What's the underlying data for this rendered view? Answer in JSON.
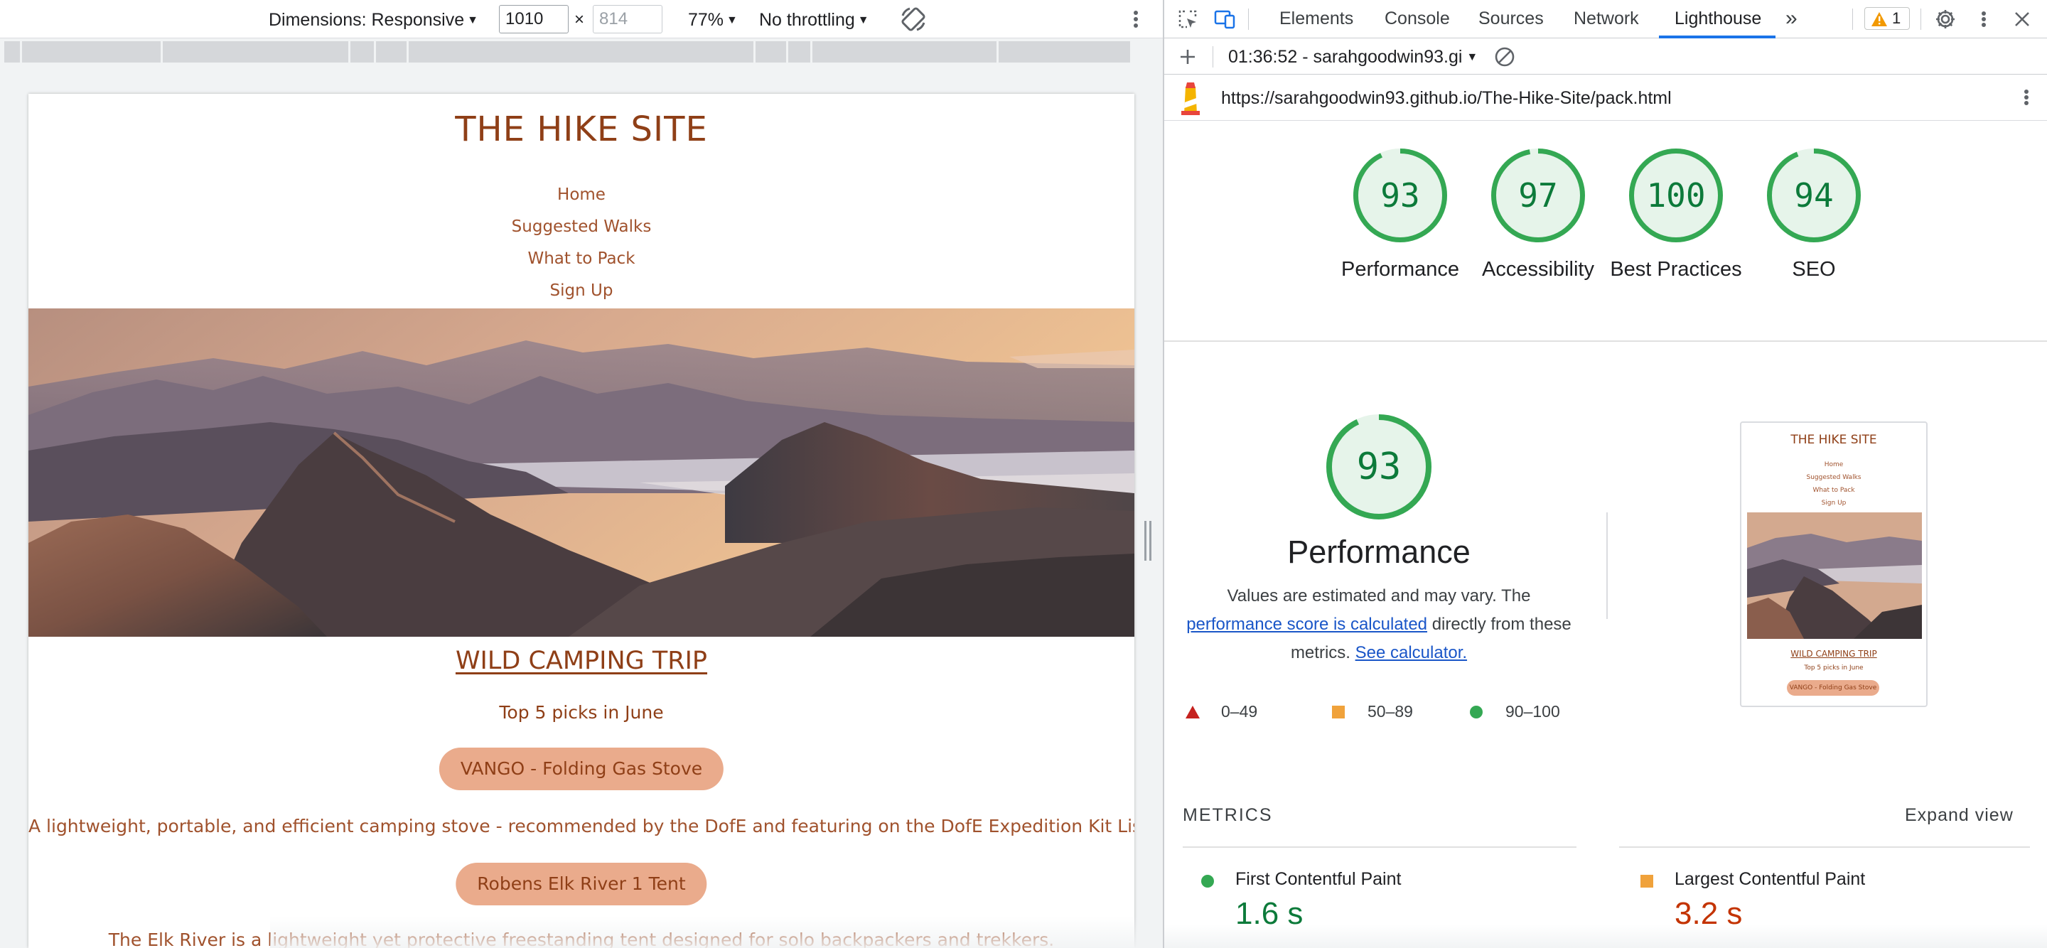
{
  "device_toolbar": {
    "dimensions_label": "Dimensions: Responsive",
    "width_value": "1010",
    "height_placeholder": "814",
    "times": "×",
    "zoom": "77%",
    "throttling": "No throttling",
    "rotate_icon": "rotate-icon",
    "more_icon": "more-vert-icon"
  },
  "site": {
    "title": "THE HIKE SITE",
    "nav": [
      "Home",
      "Suggested Walks",
      "What to Pack",
      "Sign Up"
    ],
    "hero_image": "mountain-sunset-hero-image",
    "heading": "WILD CAMPING TRIP",
    "subheading": "Top 5 picks in June",
    "items": [
      {
        "name": "VANGO - Folding Gas Stove",
        "description": "A lightweight, portable, and efficient camping stove - recommended by the DofE and featuring on the DofE Expedition Kit List."
      },
      {
        "name": "Robens Elk River 1 Tent",
        "description": "The Elk River is a lightweight yet protective freestanding tent designed for solo backpackers and trekkers."
      }
    ]
  },
  "devtools": {
    "tabs": [
      "Elements",
      "Console",
      "Sources",
      "Network",
      "Lighthouse"
    ],
    "active_tab": "Lighthouse",
    "more_tabs": "»",
    "issues_count": "1",
    "icons": {
      "inspect": "inspect-element-icon",
      "device": "device-toggle-icon",
      "settings": "gear-icon",
      "more": "more-vert-icon",
      "close": "close-icon",
      "warning": "warning-icon"
    },
    "lighthouse_toolbar": {
      "add_icon": "plus-icon",
      "report_label": "01:36:52 - sarahgoodwin93.gi",
      "clear_icon": "clear-icon"
    },
    "url": "https://sarahgoodwin93.github.io/The-Hike-Site/pack.html",
    "lighthouse_logo": "lighthouse-logo-icon",
    "scores": [
      {
        "label": "Performance",
        "value": 93
      },
      {
        "label": "Accessibility",
        "value": 97
      },
      {
        "label": "Best Practices",
        "value": 100
      },
      {
        "label": "SEO",
        "value": 94
      }
    ],
    "performance": {
      "score": 93,
      "title": "Performance",
      "desc_prefix": "Values are estimated and may vary. The",
      "desc_link": "performance score is calculated",
      "desc_middle": "directly from these metrics.",
      "calc_link": "See calculator."
    },
    "legend": [
      {
        "range": "0–49",
        "color": "#c5221f",
        "shape": "triangle"
      },
      {
        "range": "50–89",
        "color": "#f0a23b",
        "shape": "square"
      },
      {
        "range": "90–100",
        "color": "#34a853",
        "shape": "circle"
      }
    ],
    "thumbnail": {
      "title": "THE HIKE SITE",
      "nav": [
        "Home",
        "Suggested Walks",
        "What to Pack",
        "Sign Up"
      ],
      "heading": "WILD CAMPING TRIP",
      "subheading": "Top 5 picks in June",
      "pill": "VANGO - Folding Gas Stove"
    },
    "metrics": {
      "title": "METRICS",
      "expand": "Expand view",
      "items": [
        {
          "label": "First Contentful Paint",
          "value": "1.6 s",
          "status": "pass",
          "color": "#0c7a3a"
        },
        {
          "label": "Largest Contentful Paint",
          "value": "3.2 s",
          "status": "average",
          "color": "#c33300"
        }
      ]
    },
    "colors": {
      "pass": "#0c7a3a",
      "ring": "#34a853",
      "ring_bg": "#e6f4ea",
      "accent": "#1a73e8",
      "brand_brown": "#8f3f17",
      "pill": "#eaab8c"
    }
  }
}
